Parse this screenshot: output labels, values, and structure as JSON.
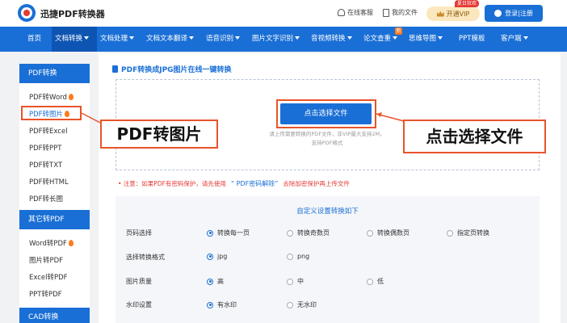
{
  "topbar": {
    "app_name": "迅捷PDF转换器",
    "service_label": "在线客服",
    "my_files_label": "我的文件",
    "vip_badge": "夏日狂欢",
    "vip_label": "开通VIP",
    "login_label": "登录|注册"
  },
  "nav": {
    "hot_badge": "新",
    "items": [
      {
        "label": "首页"
      },
      {
        "label": "文档转换"
      },
      {
        "label": "文档处理"
      },
      {
        "label": "文档文本翻译"
      },
      {
        "label": "语音识别"
      },
      {
        "label": "图片文字识别"
      },
      {
        "label": "音视频转换"
      },
      {
        "label": "论文查重"
      },
      {
        "label": "思维导图"
      },
      {
        "label": "PPT模板"
      },
      {
        "label": "客户端"
      }
    ]
  },
  "sidebar": {
    "group1_title": "PDF转换",
    "group1_items": [
      {
        "label": "PDF转Word"
      },
      {
        "label": "PDF转图片"
      },
      {
        "label": "PDF转Excel"
      },
      {
        "label": "PDF转PPT"
      },
      {
        "label": "PDF转TXT"
      },
      {
        "label": "PDF转HTML"
      },
      {
        "label": "PDF转长图"
      }
    ],
    "group2_title": "其它转PDF",
    "group2_items": [
      {
        "label": "Word转PDF"
      },
      {
        "label": "图片转PDF"
      },
      {
        "label": "Excel转PDF"
      },
      {
        "label": "PPT转PDF"
      }
    ],
    "group3_title": "CAD转换"
  },
  "main": {
    "section_title": "PDF转换成JPG图片在线一键转换",
    "upload_button": "点击选择文件",
    "upload_hint_1": "请上传需要转换的PDF文件，非VIP最大支持2M，",
    "upload_hint_2": "支持PDF格式",
    "notice_prefix": "•  注意：如果PDF有密码保护，请先使用",
    "notice_link": "“ PDF密码解除”",
    "notice_suffix": "去除加密保护再上传文件"
  },
  "settings": {
    "title": "自定义设置转换如下",
    "rows": [
      {
        "label": "页码选择",
        "options": [
          "转换每一页",
          "转换奇数页",
          "转换偶数页",
          "指定页转换"
        ],
        "selected": 0
      },
      {
        "label": "选择转换格式",
        "options": [
          "jpg",
          "png"
        ],
        "selected": 0
      },
      {
        "label": "图片质量",
        "options": [
          "高",
          "中",
          "低"
        ],
        "selected": 0
      },
      {
        "label": "水印设置",
        "options": [
          "有水印",
          "无水印"
        ],
        "selected": 0
      }
    ]
  },
  "callouts": {
    "left": "PDF转图片",
    "right": "点击选择文件"
  },
  "colors": {
    "brand_blue": "#1a6fd6",
    "callout_orange": "#e8542a",
    "notice_red": "#e53935"
  }
}
